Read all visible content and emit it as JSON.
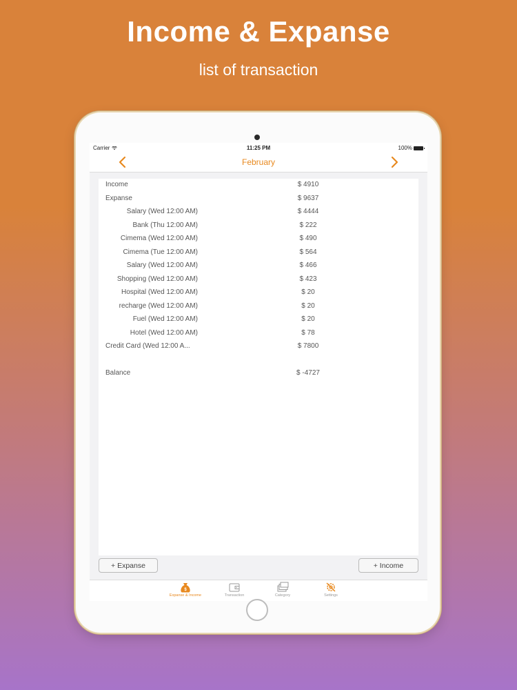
{
  "promo": {
    "title": "Income & Expanse",
    "subtitle": "list of transaction"
  },
  "status_bar": {
    "carrier": "Carrier",
    "time": "11:25 PM",
    "battery": "100%"
  },
  "nav": {
    "title": "February"
  },
  "summary": {
    "income_label": "Income",
    "income_value": "$ 4910",
    "expense_label": "Expanse",
    "expense_value": "$ 9637",
    "balance_label": "Balance",
    "balance_value": "$ -4727"
  },
  "transactions": [
    {
      "label": "Salary (Wed 12:00 AM)",
      "amount": "$ 4444"
    },
    {
      "label": "Bank (Thu 12:00 AM)",
      "amount": "$ 222"
    },
    {
      "label": "Cimema (Wed 12:00 AM)",
      "amount": "$ 490"
    },
    {
      "label": "Cimema (Tue 12:00 AM)",
      "amount": "$ 564"
    },
    {
      "label": "Salary (Wed 12:00 AM)",
      "amount": "$ 466"
    },
    {
      "label": "Shopping (Wed 12:00 AM)",
      "amount": "$ 423"
    },
    {
      "label": "Hospital (Wed 12:00 AM)",
      "amount": "$ 20"
    },
    {
      "label": "recharge (Wed 12:00 AM)",
      "amount": "$ 20"
    },
    {
      "label": "Fuel (Wed 12:00 AM)",
      "amount": "$ 20"
    },
    {
      "label": "Hotel (Wed 12:00 AM)",
      "amount": "$ 78"
    },
    {
      "label": "Credit Card (Wed 12:00 A...",
      "amount": "$ 7800"
    }
  ],
  "buttons": {
    "add_expense": "+ Expanse",
    "add_income": "+ Income"
  },
  "tabs": [
    {
      "label": "Expanse & Income",
      "icon": "money-bag-icon",
      "active": true
    },
    {
      "label": "Transaction",
      "icon": "wallet-icon",
      "active": false
    },
    {
      "label": "Category",
      "icon": "cards-icon",
      "active": false
    },
    {
      "label": "Settings",
      "icon": "gear-wrench-icon",
      "active": false
    }
  ],
  "colors": {
    "accent": "#e8891f",
    "background_top": "#d9823a",
    "background_bottom": "#a774c9"
  }
}
